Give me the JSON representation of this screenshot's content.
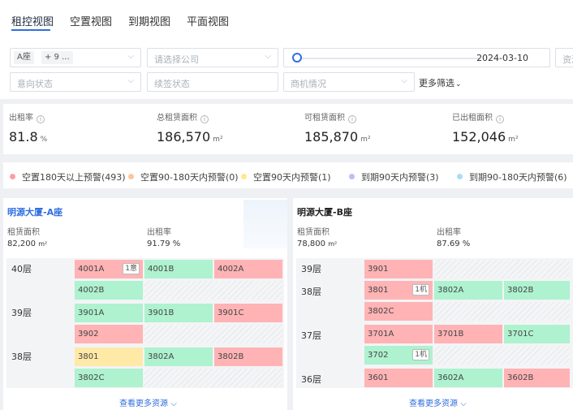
{
  "tabs": [
    {
      "label": "租控视图",
      "active": true
    },
    {
      "label": "空置视图",
      "active": false
    },
    {
      "label": "到期视图",
      "active": false
    },
    {
      "label": "平面视图",
      "active": false
    }
  ],
  "filters": {
    "building_tag": "A座",
    "building_more": "+ 9 ...",
    "company_placeholder": "请选择公司",
    "date_value": "2024-03-10",
    "asset_placeholder": "资源",
    "intent_placeholder": "意向状态",
    "renew_placeholder": "续签状态",
    "opportunity_placeholder": "商机情况",
    "more_filter_label": "更多筛选"
  },
  "stats": [
    {
      "label": "出租率",
      "value": "81.8",
      "unit": "%"
    },
    {
      "label": "总租赁面积",
      "value": "186,570",
      "unit": "m²"
    },
    {
      "label": "可租赁面积",
      "value": "185,870",
      "unit": "m²"
    },
    {
      "label": "已出租面积",
      "value": "152,046",
      "unit": "m²"
    }
  ],
  "legend": [
    {
      "label": "空置180天以上预警(493)",
      "color": "#ff9ea2"
    },
    {
      "label": "空置90-180天内预警(0)",
      "color": "#ffc49a"
    },
    {
      "label": "空置90天内预警(1)",
      "color": "#ffe98a"
    },
    {
      "label": "到期90天内预警(3)",
      "color": "#b9bff7"
    },
    {
      "label": "到期90-180天内预警(6)",
      "color": "#a9dcf7"
    }
  ],
  "buildings": [
    {
      "title": "明源大厦-A座",
      "area_label": "租赁面积",
      "area_value": "82,200",
      "area_unit": "m²",
      "rate_label": "出租率",
      "rate_value": "91.79 %",
      "floors": [
        "40层",
        "39层",
        "38层"
      ],
      "cells": [
        {
          "name": "4001A",
          "badge": "1意"
        },
        {
          "name": "4001B",
          "badge": ""
        },
        {
          "name": "4002A",
          "badge": ""
        },
        {
          "name": "4002B",
          "badge": ""
        },
        {
          "name": "3901A",
          "badge": ""
        },
        {
          "name": "3901B",
          "badge": ""
        },
        {
          "name": "3901C",
          "badge": ""
        },
        {
          "name": "3902",
          "badge": ""
        },
        {
          "name": "3801",
          "badge": ""
        },
        {
          "name": "3802A",
          "badge": ""
        },
        {
          "name": "3802B",
          "badge": ""
        },
        {
          "name": "3802C",
          "badge": ""
        }
      ],
      "see_more": "查看更多资源"
    },
    {
      "title": "明源大厦-B座",
      "area_label": "租赁面积",
      "area_value": "78,800",
      "area_unit": "m²",
      "rate_label": "出租率",
      "rate_value": "87.69 %",
      "floors": [
        "39层",
        "38层",
        "37层",
        "36层"
      ],
      "cells": [
        {
          "name": "3901",
          "badge": ""
        },
        {
          "name": "3801",
          "badge": "1机"
        },
        {
          "name": "3802A",
          "badge": ""
        },
        {
          "name": "3802B",
          "badge": ""
        },
        {
          "name": "3802C",
          "badge": ""
        },
        {
          "name": "3701A",
          "badge": ""
        },
        {
          "name": "3701B",
          "badge": ""
        },
        {
          "name": "3701C",
          "badge": ""
        },
        {
          "name": "3702",
          "badge": "1机"
        },
        {
          "name": "3601",
          "badge": ""
        },
        {
          "name": "3602A",
          "badge": ""
        },
        {
          "name": "3602B",
          "badge": ""
        }
      ],
      "see_more": "查看更多资源"
    }
  ]
}
